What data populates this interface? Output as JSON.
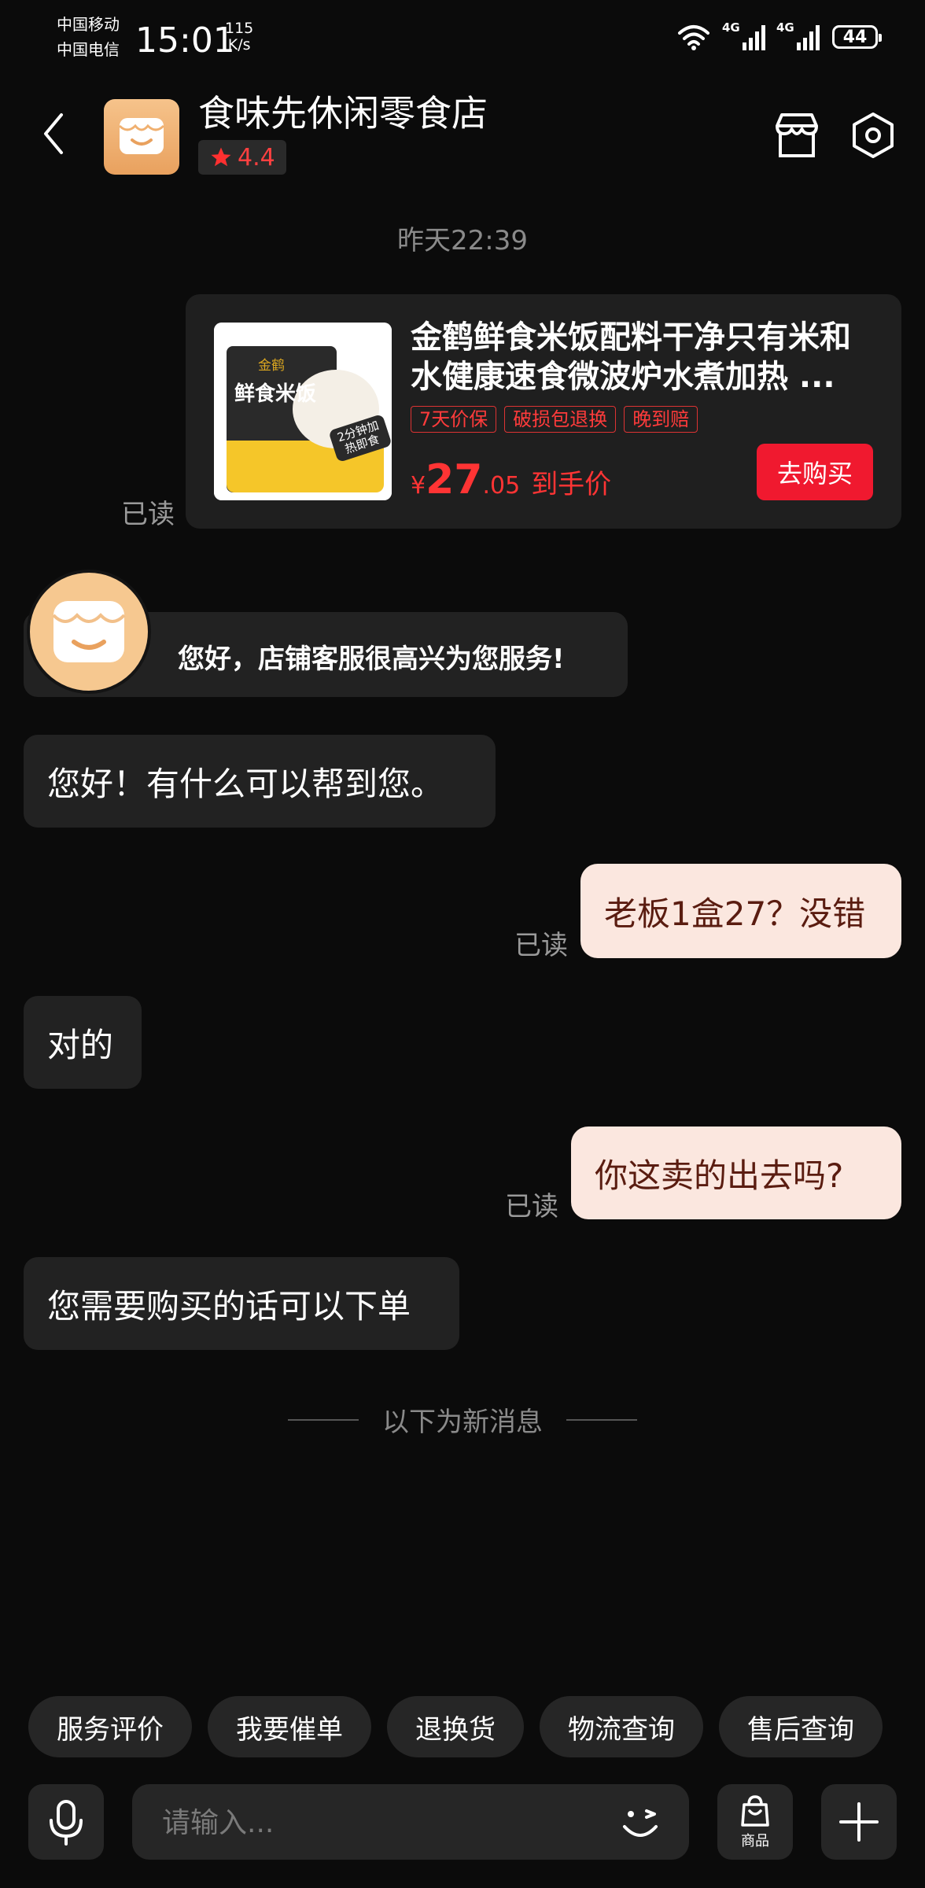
{
  "status_bar": {
    "carrier_1": "中国移动",
    "carrier_2": "中国电信",
    "time": "15:01",
    "net_speed_value": "115",
    "net_speed_unit": "K/s",
    "network_1": "4G",
    "network_2": "4G",
    "battery": "44"
  },
  "header": {
    "shop_name": "食味先休闲零食店",
    "rating": "4.4"
  },
  "chat": {
    "timestamp": "昨天22:39",
    "product_card": {
      "image_brand": "金鹤",
      "image_label": "鲜食米饭",
      "image_badge": "2分钟加热即食",
      "title": "金鹤鲜食米饭配料干净只有米和水健康速食微波炉水煮加热 ...",
      "tags": [
        "7天价保",
        "破损包退换",
        "晚到赔"
      ],
      "price_currency": "¥",
      "price_integer": "27",
      "price_decimal": ".05",
      "price_label": "到手价",
      "buy_button": "去购买",
      "read_status": "已读"
    },
    "welcome_message": "您好，店铺客服很高兴为您服务!",
    "messages": [
      {
        "side": "left",
        "text": "您好！有什么可以帮到您。"
      },
      {
        "side": "right",
        "text": "老板1盒27？没错",
        "read": "已读"
      },
      {
        "side": "left",
        "text": "对的"
      },
      {
        "side": "right",
        "text": "你这卖的出去吗?",
        "read": "已读"
      },
      {
        "side": "left",
        "text": "您需要购买的话可以下单"
      }
    ],
    "new_messages_divider": "以下为新消息"
  },
  "quick_replies": [
    "服务评价",
    "我要催单",
    "退换货",
    "物流查询",
    "售后查询"
  ],
  "input_bar": {
    "placeholder": "请输入...",
    "product_button_label": "商品"
  },
  "colors": {
    "background": "#0b0b0b",
    "accent_red": "#f0192f",
    "user_bubble": "#fbe7df",
    "other_bubble": "#222222"
  }
}
